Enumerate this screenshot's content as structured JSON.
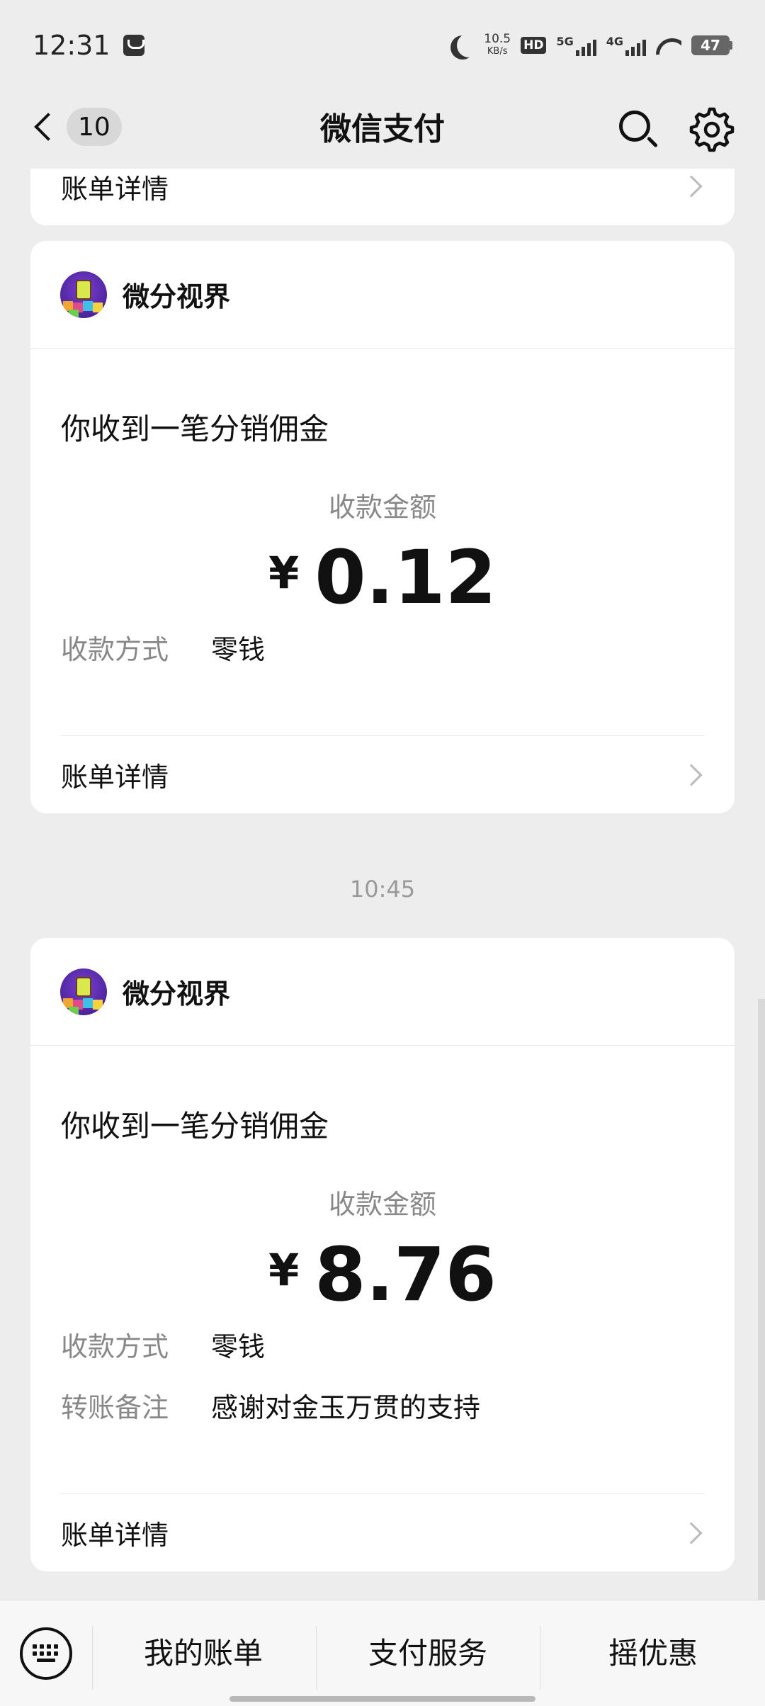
{
  "status_bar": {
    "time": "12:31",
    "net_speed_value": "10.5",
    "net_speed_unit": "KB/s",
    "hd_label": "HD",
    "sim1_label": "5G",
    "sim2_label": "4G",
    "battery": "47"
  },
  "header": {
    "title": "微信支付",
    "unread_count": "10"
  },
  "cards": [
    {
      "detail_label": "账单详情"
    },
    {
      "merchant": "微分视界",
      "title": "你收到一笔分销佣金",
      "amount_label": "收款金额",
      "currency": "¥",
      "amount": "0.12",
      "method_key": "收款方式",
      "method_value": "零钱",
      "detail_label": "账单详情"
    },
    {
      "merchant": "微分视界",
      "title": "你收到一笔分销佣金",
      "amount_label": "收款金额",
      "currency": "¥",
      "amount": "8.76",
      "method_key": "收款方式",
      "method_value": "零钱",
      "note_key": "转账备注",
      "note_value": "感谢对金玉万贯的支持",
      "detail_label": "账单详情"
    }
  ],
  "timestamp": "10:45",
  "bottom_nav": {
    "items": [
      "我的账单",
      "支付服务",
      "摇优惠"
    ]
  },
  "icons": [
    "moon-icon",
    "notification-icon",
    "wifi-icon",
    "signal-icon",
    "back-chevron-icon",
    "search-icon",
    "settings-icon",
    "chevron-right-icon",
    "keyboard-icon"
  ]
}
